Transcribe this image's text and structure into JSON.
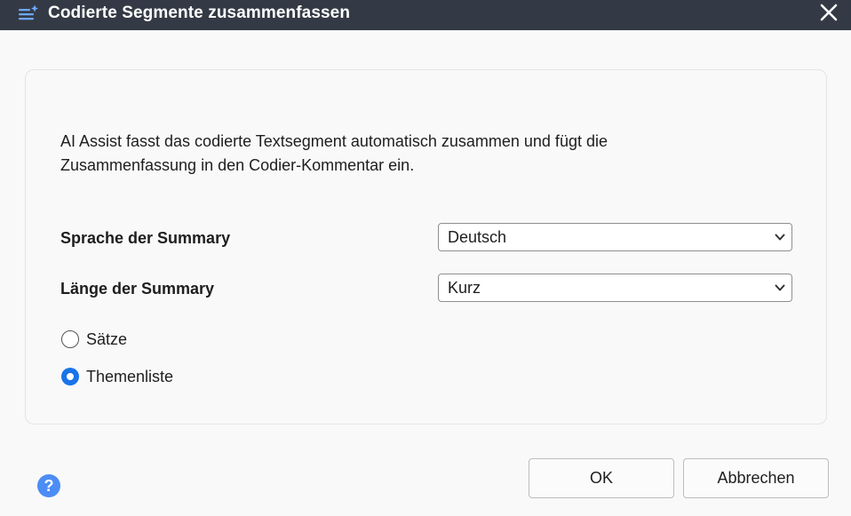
{
  "window": {
    "title": "Codierte Segmente zusammenfassen",
    "title_icon": "ai-list-icon",
    "close_icon": "close-icon"
  },
  "description": {
    "line1": "AI Assist fasst das codierte Textsegment automatisch zusammen und fügt die",
    "line2": "Zusammenfassung in den Codier-Kommentar ein."
  },
  "language": {
    "label": "Sprache der Summary",
    "selected": "Deutsch"
  },
  "length": {
    "label": "Länge der Summary",
    "selected": "Kurz"
  },
  "format_options": [
    {
      "label": "Sätze",
      "selected": false
    },
    {
      "label": "Themenliste",
      "selected": true
    }
  ],
  "help": {
    "glyph": "?"
  },
  "buttons": {
    "ok_label": "OK",
    "cancel_label": "Abbrechen"
  },
  "colors": {
    "titlebar": "#343a45",
    "accent": "#1a73e8",
    "help": "#4c8df5"
  }
}
